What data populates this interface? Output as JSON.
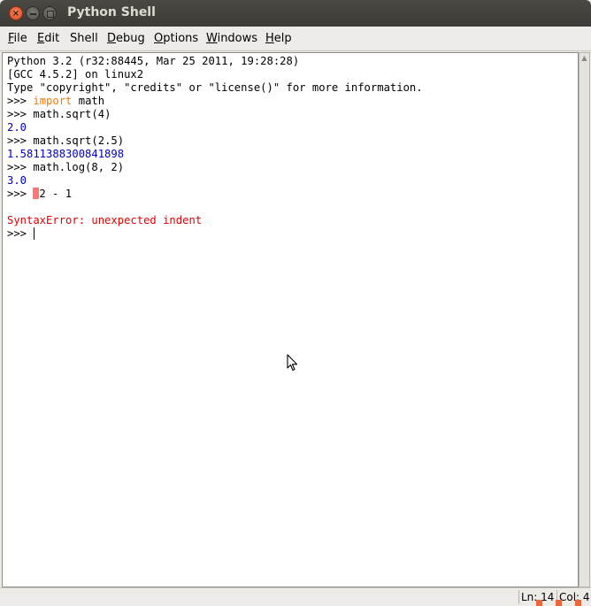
{
  "window": {
    "title": "Python Shell",
    "close_glyph": "×",
    "colors": {
      "titlebar": "#3c3b37",
      "close_button": "#df4b21"
    }
  },
  "menubar": {
    "items": [
      {
        "label": "File",
        "mnemonic": "F",
        "rest": "ile"
      },
      {
        "label": "Edit",
        "mnemonic": "E",
        "rest": "dit"
      },
      {
        "label": "Shell",
        "mnemonic": "S",
        "rest": "hell"
      },
      {
        "label": "Debug",
        "mnemonic": "D",
        "rest": "ebug"
      },
      {
        "label": "Options",
        "mnemonic": "O",
        "rest": "ptions"
      },
      {
        "label": "Windows",
        "mnemonic": "W",
        "rest": "indows"
      },
      {
        "label": "Help",
        "mnemonic": "H",
        "rest": "elp"
      }
    ]
  },
  "shell": {
    "colors": {
      "default": "#000000",
      "keyword": "#ff7700",
      "output": "#0000c0",
      "error": "#e00000",
      "error_mark": "#ff7777"
    },
    "lines": [
      {
        "segments": [
          {
            "text": "Python 3.2 (r32:88445, Mar 25 2011, 19:28:28)",
            "kind": "default"
          }
        ]
      },
      {
        "segments": [
          {
            "text": "[GCC 4.5.2] on linux2",
            "kind": "default"
          }
        ]
      },
      {
        "segments": [
          {
            "text": "Type \"copyright\", \"credits\" or \"license()\" for more information.",
            "kind": "default"
          }
        ]
      },
      {
        "segments": [
          {
            "text": ">>> ",
            "kind": "prompt"
          },
          {
            "text": "import",
            "kind": "keyword"
          },
          {
            "text": " math",
            "kind": "default"
          }
        ]
      },
      {
        "segments": [
          {
            "text": ">>> ",
            "kind": "prompt"
          },
          {
            "text": "math.sqrt(4)",
            "kind": "default"
          }
        ]
      },
      {
        "segments": [
          {
            "text": "2.0",
            "kind": "output"
          }
        ]
      },
      {
        "segments": [
          {
            "text": ">>> ",
            "kind": "prompt"
          },
          {
            "text": "math.sqrt(2.5)",
            "kind": "default"
          }
        ]
      },
      {
        "segments": [
          {
            "text": "1.5811388300841898",
            "kind": "output"
          }
        ]
      },
      {
        "segments": [
          {
            "text": ">>> ",
            "kind": "prompt"
          },
          {
            "text": "math.log(8, 2)",
            "kind": "default"
          }
        ]
      },
      {
        "segments": [
          {
            "text": "3.0",
            "kind": "output"
          }
        ]
      },
      {
        "segments": [
          {
            "text": ">>> ",
            "kind": "prompt"
          },
          {
            "text": " ",
            "kind": "errmark"
          },
          {
            "text": "2 - 1",
            "kind": "default"
          }
        ]
      },
      {
        "segments": [
          {
            "text": "",
            "kind": "default"
          }
        ]
      },
      {
        "segments": [
          {
            "text": "SyntaxError: unexpected indent",
            "kind": "error"
          }
        ]
      },
      {
        "segments": [
          {
            "text": ">>> ",
            "kind": "prompt"
          },
          {
            "text": "",
            "kind": "caret"
          }
        ]
      }
    ]
  },
  "statusbar": {
    "line": "Ln: 14",
    "col": "Col: 4"
  }
}
